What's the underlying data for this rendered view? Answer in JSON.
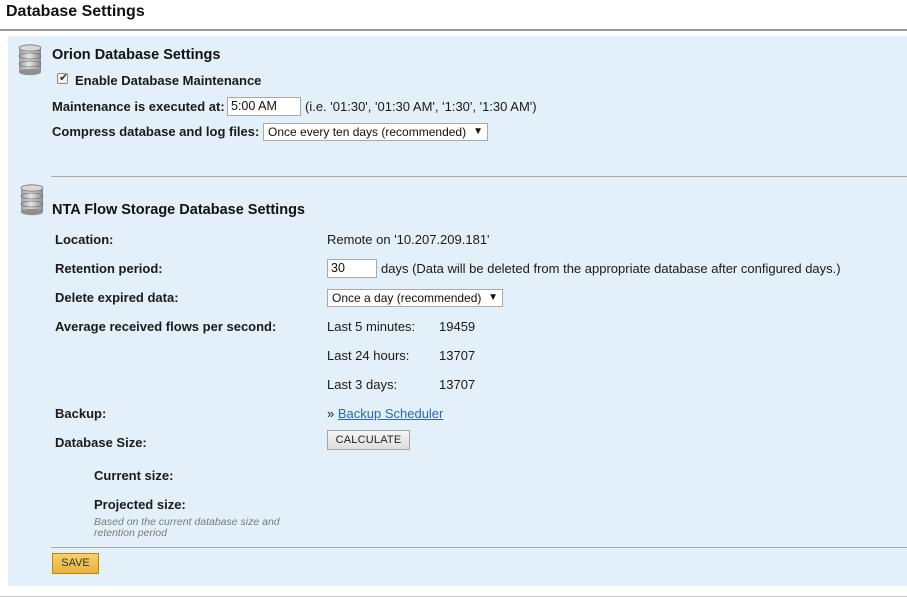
{
  "page": {
    "title": "Database Settings"
  },
  "orion": {
    "title": "Orion Database Settings",
    "enable_maintenance_label": "Enable Database Maintenance",
    "enable_maintenance_checked": true,
    "maintenance_time_label": "Maintenance is executed at:",
    "maintenance_time_value": "5:00 AM",
    "maintenance_time_hint": "(i.e. '01:30', '01:30 AM', '1:30', '1:30 AM')",
    "compress_label": "Compress database and log files:",
    "compress_value": "Once every ten days (recommended)"
  },
  "nta": {
    "title": "NTA Flow Storage Database Settings",
    "location_label": "Location:",
    "location_value": "Remote on '10.207.209.181'",
    "retention_label": "Retention period:",
    "retention_value": "30",
    "retention_hint": "days (Data will be deleted from the appropriate database after configured days.)",
    "delete_label": "Delete expired data:",
    "delete_value": "Once a day (recommended)",
    "avg_flows_label": "Average received flows per second:",
    "flows": [
      {
        "label": "Last 5 minutes:",
        "value": "19459"
      },
      {
        "label": "Last 24 hours:",
        "value": "13707"
      },
      {
        "label": "Last 3 days:",
        "value": "13707"
      }
    ],
    "backup_label": "Backup:",
    "backup_prefix": "»",
    "backup_link": "Backup Scheduler",
    "db_size_label": "Database Size:",
    "calculate_button": "CALCULATE",
    "current_size_label": "Current size:",
    "projected_size_label": "Projected size:",
    "projected_hint_line1": "Based on the current database size and",
    "projected_hint_line2": "retention period"
  },
  "actions": {
    "save_button": "SAVE"
  },
  "icons": {
    "section_icon": "database-icon"
  },
  "colors": {
    "panel_bg": "#e3f0f9",
    "save_button": "#f0c050",
    "link": "#2a6aa8"
  }
}
